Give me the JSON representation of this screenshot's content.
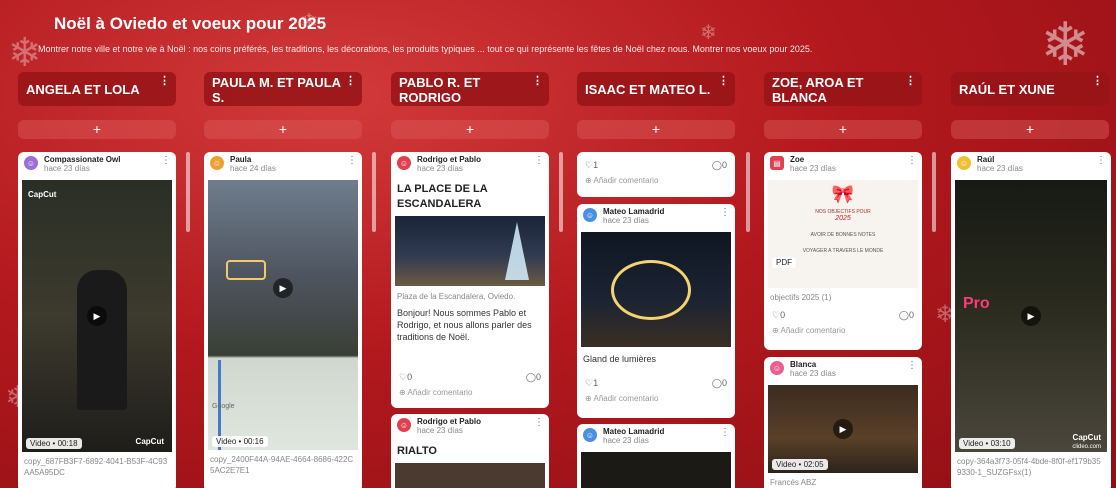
{
  "header": {
    "title": "Noël à Oviedo et voeux pour 2025",
    "description": "Montrer notre ville et notre vie à Noël : nos coins préférés, les traditions, les décorations, les produits typiques ... tout ce qui représente les fêtes de Noël chez nous. Montrer nos voeux pour 2025."
  },
  "columns": [
    {
      "title": "ANGELA ET LOLA",
      "add": "+"
    },
    {
      "title": "PAULA M. ET PAULA S.",
      "add": "+"
    },
    {
      "title": "PABLO R. ET RODRIGO",
      "add": "+"
    },
    {
      "title": "ISAAC ET MATEO L.",
      "add": "+"
    },
    {
      "title": "ZOE, AROA ET BLANCA",
      "add": "+"
    },
    {
      "title": "RAÚL ET XUNE",
      "add": "+"
    }
  ],
  "cards": {
    "c1": {
      "author": "Compassionate Owl",
      "time": "hace 23 días",
      "video": "Video • 00:18",
      "caption": "copy_687FB3F7-6892-4041-B53F-4C93AA5A95DC",
      "logo": "CapCut",
      "logo2": "CapCut"
    },
    "c2": {
      "author": "Paula",
      "time": "hace 24 días",
      "video": "Video • 00:16",
      "caption": "copy_2400F44A-94AE-4664-8686-422C5AC2E7E1",
      "map_label": "Google"
    },
    "c3": {
      "author": "Rodrigo et Pablo",
      "time": "hace 23 días",
      "title": "LA PLACE DE LA ESCANDALERA",
      "location": "Plaza de la Escandalera, Oviedo.",
      "text": "Bonjour! Nous sommes Pablo et Rodrigo, et nous allons parler des traditions de Noël.",
      "likes": "0",
      "comments": "0",
      "add_comment": "Añadir comentario"
    },
    "c4": {
      "author": "Rodrigo et Pablo",
      "time": "hace 23 días",
      "title": "RIALTO"
    },
    "c5": {
      "likes": "1",
      "comments": "0",
      "add_comment": "Añadir comentario"
    },
    "c6": {
      "author": "Mateo Lamadrid",
      "time": "hace 23 días",
      "caption": "Gland de lumières",
      "likes": "1",
      "comments": "0",
      "add_comment": "Añadir comentario"
    },
    "c7": {
      "author": "Mateo Lamadrid",
      "time": "hace 23 días"
    },
    "c8": {
      "author": "Zoe",
      "time": "hace 23 días",
      "pdf": "PDF",
      "doc_heading": "NOS OBJECTIFS POUR",
      "doc_year": "2025",
      "doc_line1": "AVOIR DE BONNES NOTES",
      "doc_line2": "VOYAGER A TRAVERS LE MONDE",
      "caption": "objectifs 2025 (1)",
      "likes": "0",
      "comments": "0",
      "add_comment": "Añadir comentario"
    },
    "c9": {
      "author": "Blanca",
      "time": "hace 23 días",
      "video": "Video • 02:05",
      "caption": "Francés ABZ"
    },
    "c10": {
      "author": "Raúl",
      "time": "hace 23 días",
      "video": "Video • 03:10",
      "caption": "copy-364a3f73-05f4-4bde-8f0f-ef179b359330-1_SUZGFsx(1)",
      "logo": "CapCut",
      "logo_sub": "clideo.com",
      "overlay": "Pro"
    }
  },
  "colors": {
    "accent": "#b3191e",
    "header": "#96141a"
  }
}
